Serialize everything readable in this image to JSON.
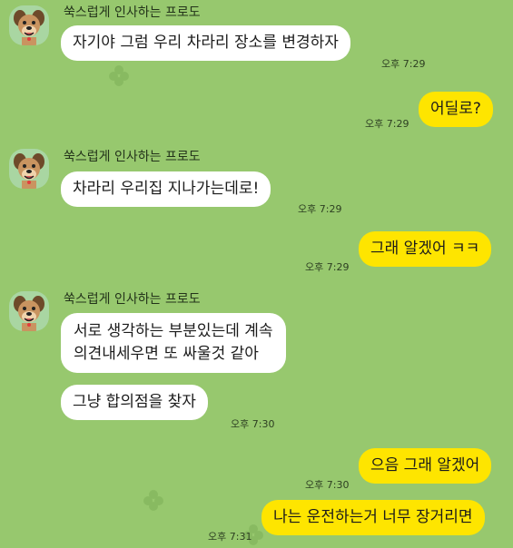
{
  "sender_name": "쑥스럽게 인사하는 프로도",
  "avatar_icon": "frodo-dog-avatar-icon",
  "colors": {
    "background": "#97c86e",
    "incoming_bubble": "#ffffff",
    "outgoing_bubble": "#fee500"
  },
  "messages": [
    {
      "dir": "in",
      "text": "자기야 그럼 우리 차라리 장소를 변경하자",
      "time": "오후 7:29"
    },
    {
      "dir": "out",
      "text": "어딜로?",
      "time": "오후 7:29"
    },
    {
      "dir": "in",
      "text": "차라리 우리집 지나가는데로!",
      "time": "오후 7:29"
    },
    {
      "dir": "out",
      "text": "그래 알겠어 ㅋㅋ",
      "time": "오후 7:29"
    },
    {
      "dir": "in",
      "text_line1": "서로 생각하는 부분있는데 계속",
      "text_line2": "의견내세우면 또 싸울것 같아"
    },
    {
      "dir": "in",
      "text": "그냥 합의점을 찾자",
      "time": "오후 7:30"
    },
    {
      "dir": "out",
      "text": "으음 그래 알겠어",
      "time": "오후 7:30"
    },
    {
      "dir": "out",
      "text": "나는 운전하는거 너무 장거리면",
      "time": "오후 7:31"
    }
  ]
}
